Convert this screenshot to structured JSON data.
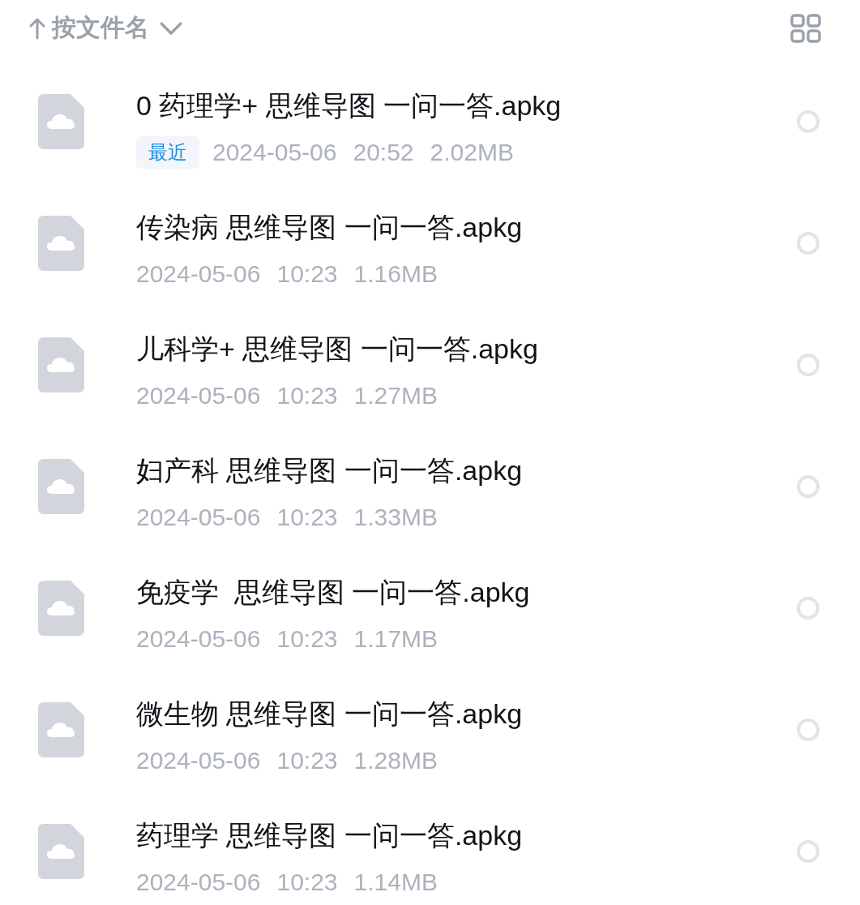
{
  "header": {
    "sort_label": "按文件名"
  },
  "files": [
    {
      "name": "0 药理学+ 思维导图 一问一答.apkg",
      "badge": "最近",
      "date": "2024-05-06",
      "time": "20:52",
      "size": "2.02MB",
      "selected": false
    },
    {
      "name": "传染病 思维导图 一问一答.apkg",
      "date": "2024-05-06",
      "time": "10:23",
      "size": "1.16MB",
      "selected": false
    },
    {
      "name": "儿科学+ 思维导图 一问一答.apkg",
      "date": "2024-05-06",
      "time": "10:23",
      "size": "1.27MB",
      "selected": false
    },
    {
      "name": "妇产科 思维导图 一问一答.apkg",
      "date": "2024-05-06",
      "time": "10:23",
      "size": "1.33MB",
      "selected": false
    },
    {
      "name": "免疫学  思维导图 一问一答.apkg",
      "date": "2024-05-06",
      "time": "10:23",
      "size": "1.17MB",
      "selected": false
    },
    {
      "name": "微生物 思维导图 一问一答.apkg",
      "date": "2024-05-06",
      "time": "10:23",
      "size": "1.28MB",
      "selected": false
    },
    {
      "name": "药理学 思维导图 一问一答.apkg",
      "date": "2024-05-06",
      "time": "10:23",
      "size": "1.14MB",
      "selected": false
    }
  ]
}
